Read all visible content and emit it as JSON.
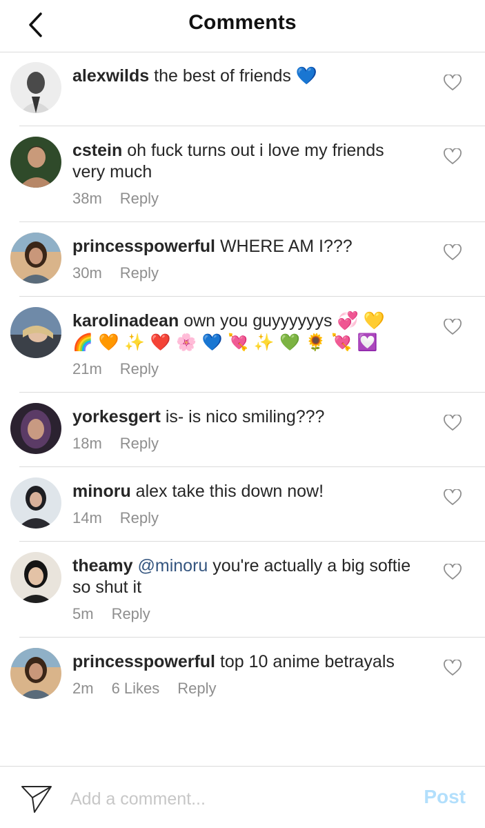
{
  "header": {
    "title": "Comments",
    "back_icon": "chevron-left-icon"
  },
  "comments": [
    {
      "username": "alexwilds",
      "text": "the best of friends 💙",
      "time": "",
      "reply": ""
    },
    {
      "username": "cstein",
      "text": "oh fuck turns out i love my friends very much",
      "time": "38m",
      "reply": "Reply"
    },
    {
      "username": "princesspowerful",
      "text": "WHERE AM I???",
      "time": "30m",
      "reply": "Reply"
    },
    {
      "username": "karolinadean",
      "text": "own you guyyyyyys 💞 💛",
      "emoji_line": "🌈 🧡 ✨ ❤️ 🌸 💙 💘 ✨ 💚 🌻 💘 💟",
      "time": "21m",
      "reply": "Reply"
    },
    {
      "username": "yorkesgert",
      "text": "is- is nico smiling???",
      "time": "18m",
      "reply": "Reply"
    },
    {
      "username": "minoru",
      "text": "alex take this down now!",
      "time": "14m",
      "reply": "Reply"
    },
    {
      "username": "theamy",
      "mention": "@minoru",
      "text": "you're actually a big softie so shut it",
      "time": "5m",
      "reply": "Reply"
    },
    {
      "username": "princesspowerful",
      "text": "top 10 anime betrayals",
      "time": "2m",
      "likes": "6 Likes",
      "reply": "Reply"
    }
  ],
  "footer": {
    "placeholder": "Add a comment...",
    "post_label": "Post",
    "send_icon": "paper-plane-icon"
  },
  "colors": {
    "text": "#262626",
    "meta": "#8e8e8e",
    "divider": "#dbdbdb",
    "mention": "#34557f",
    "post_disabled": "#b2dffc"
  }
}
